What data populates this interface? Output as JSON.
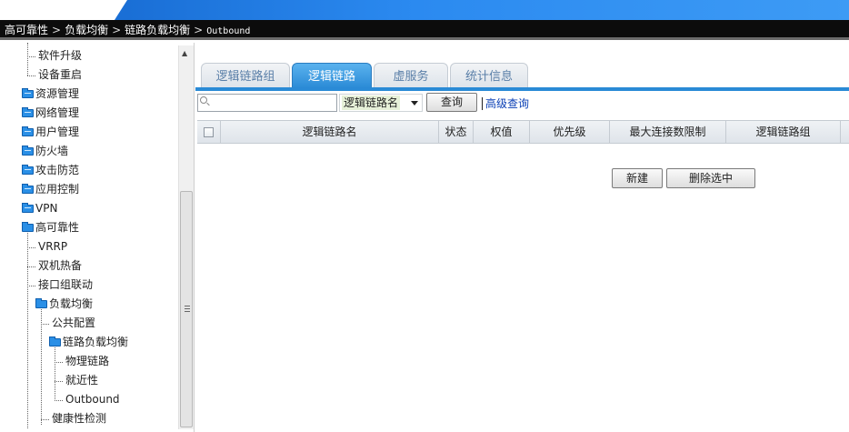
{
  "breadcrumb": {
    "items": [
      "高可靠性",
      "负载均衡",
      "链路负载均衡",
      "Outbound"
    ],
    "separator": ">"
  },
  "tree": {
    "items": [
      {
        "label": "软件升级",
        "type": "leaf"
      },
      {
        "label": "设备重启",
        "type": "leaf"
      },
      {
        "label": "资源管理",
        "type": "folder-closed"
      },
      {
        "label": "网络管理",
        "type": "folder-closed"
      },
      {
        "label": "用户管理",
        "type": "folder-closed"
      },
      {
        "label": "防火墙",
        "type": "folder-closed"
      },
      {
        "label": "攻击防范",
        "type": "folder-closed"
      },
      {
        "label": "应用控制",
        "type": "folder-closed"
      },
      {
        "label": "VPN",
        "type": "folder-closed"
      },
      {
        "label": "高可靠性",
        "type": "folder-open"
      },
      {
        "label": "VRRP",
        "type": "leaf"
      },
      {
        "label": "双机热备",
        "type": "leaf"
      },
      {
        "label": "接口组联动",
        "type": "leaf"
      },
      {
        "label": "负载均衡",
        "type": "folder-open"
      },
      {
        "label": "公共配置",
        "type": "leaf"
      },
      {
        "label": "链路负载均衡",
        "type": "folder-open"
      },
      {
        "label": "物理链路",
        "type": "leaf"
      },
      {
        "label": "就近性",
        "type": "leaf"
      },
      {
        "label": "Outbound",
        "type": "leaf"
      },
      {
        "label": "健康性检测",
        "type": "leaf"
      }
    ]
  },
  "tabs": [
    {
      "label": "逻辑链路组",
      "active": false
    },
    {
      "label": "逻辑链路",
      "active": true
    },
    {
      "label": "虚服务",
      "active": false
    },
    {
      "label": "统计信息",
      "active": false
    }
  ],
  "search": {
    "placeholder": "",
    "field_selected": "逻辑链路名",
    "query_button": "查询",
    "advanced_link": "高级查询"
  },
  "table": {
    "columns": [
      "逻辑链路名",
      "状态",
      "权值",
      "优先级",
      "最大连接数限制",
      "逻辑链路组"
    ],
    "rows": []
  },
  "actions": {
    "new_button": "新建",
    "delete_selected_button": "删除选中"
  },
  "colors": {
    "accent": "#2a8ad6",
    "breadcrumb_bg": "#0c0c0c",
    "link": "#0a3fb5"
  }
}
